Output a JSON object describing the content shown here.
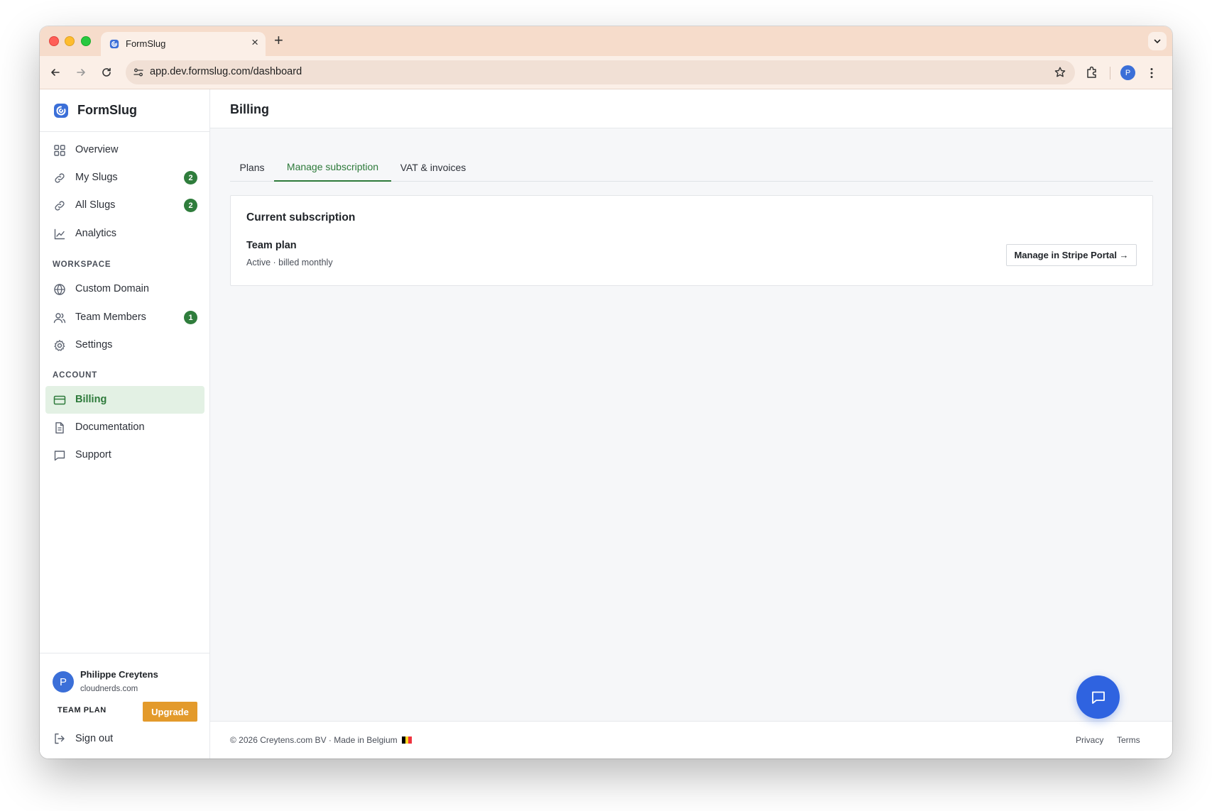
{
  "browser": {
    "tab_title": "FormSlug",
    "url": "app.dev.formslug.com/dashboard",
    "profile_initial": "P",
    "tab_close": "×",
    "new_tab": "+"
  },
  "sidebar": {
    "brand": "FormSlug",
    "items": [
      {
        "label": "Overview",
        "icon": "grid-icon"
      },
      {
        "label": "My Slugs",
        "icon": "link-icon",
        "badge": "2"
      },
      {
        "label": "All Slugs",
        "icon": "link-icon",
        "badge": "2"
      },
      {
        "label": "Analytics",
        "icon": "line-chart-icon"
      }
    ],
    "workspace_label": "WORKSPACE",
    "workspace_items": [
      {
        "label": "Custom Domain",
        "icon": "globe-icon"
      },
      {
        "label": "Team Members",
        "icon": "users-icon",
        "badge": "1"
      },
      {
        "label": "Settings",
        "icon": "gear-icon"
      }
    ],
    "account_label": "ACCOUNT",
    "account_items": [
      {
        "label": "Billing",
        "icon": "credit-card-icon",
        "active": true
      },
      {
        "label": "Documentation",
        "icon": "document-icon"
      },
      {
        "label": "Support",
        "icon": "message-icon"
      }
    ],
    "user": {
      "initial": "P",
      "name": "Philippe Creytens",
      "domain": "cloudnerds.com",
      "plan": "TEAM PLAN",
      "upgrade_label": "Upgrade"
    },
    "signout_label": "Sign out"
  },
  "main": {
    "title": "Billing",
    "tabs": [
      {
        "label": "Plans"
      },
      {
        "label": "Manage subscription",
        "active": true
      },
      {
        "label": "VAT & invoices"
      }
    ],
    "card": {
      "title": "Current subscription",
      "plan_name": "Team plan",
      "plan_status": "Active · billed monthly",
      "button_label": "Manage in Stripe Portal →"
    }
  },
  "footer": {
    "copyright": "© 2026 Creytens.com BV · Made in Belgium",
    "links": [
      "Privacy",
      "Terms"
    ]
  },
  "colors": {
    "accent_green": "#2d7a3a",
    "active_bg": "#e3f1e4",
    "upgrade": "#e39a2b",
    "fab": "#2f63e0",
    "chrome_tab": "#f6dccb"
  }
}
